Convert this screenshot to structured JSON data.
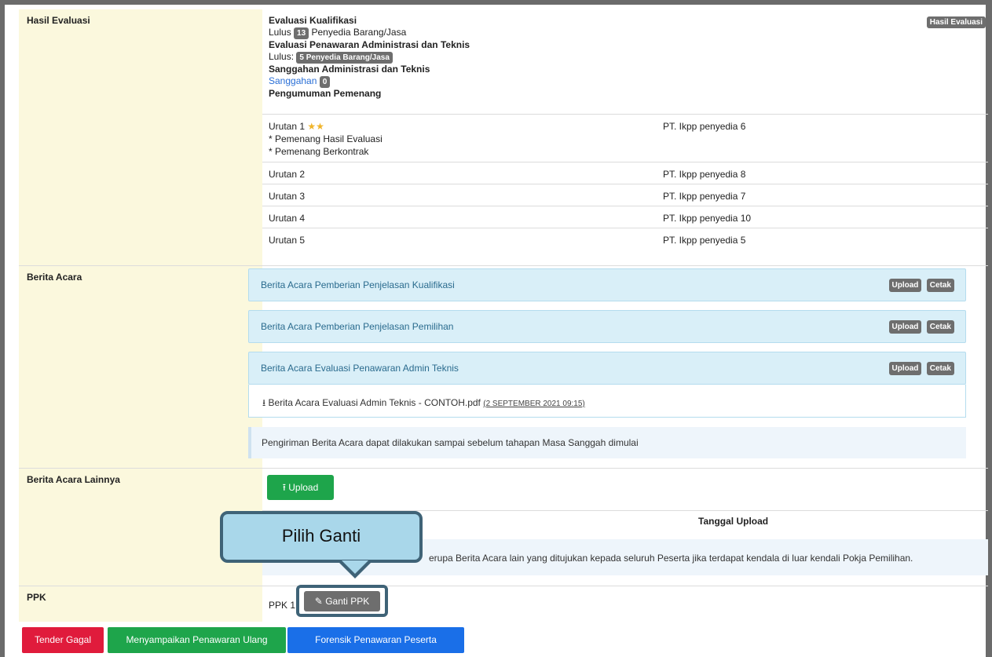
{
  "hasil_evaluasi": {
    "label": "Hasil Evaluasi",
    "corner_badge": "Hasil Evaluasi",
    "kualifikasi_title": "Evaluasi Kualifikasi",
    "kualifikasi_lulus_prefix": "Lulus",
    "kualifikasi_count": "13",
    "kualifikasi_suffix": "Penyedia Barang/Jasa",
    "penawaran_title": "Evaluasi Penawaran Administrasi dan Teknis",
    "penawaran_lulus_prefix": "Lulus:",
    "penawaran_badge": "5 Penyedia Barang/Jasa",
    "sanggahan_title": "Sanggahan Administrasi dan Teknis",
    "sanggahan_link": "Sanggahan",
    "sanggahan_count": "0",
    "pengumuman_title": "Pengumuman Pemenang",
    "urutan": [
      {
        "rank": "Urutan 1",
        "stars": "★★",
        "notes": [
          "* Pemenang Hasil Evaluasi",
          "* Pemenang Berkontrak"
        ],
        "provider": "PT. Ikpp penyedia 6"
      },
      {
        "rank": "Urutan 2",
        "provider": "PT. Ikpp penyedia 8"
      },
      {
        "rank": "Urutan 3",
        "provider": "PT. Ikpp penyedia 7"
      },
      {
        "rank": "Urutan 4",
        "provider": "PT. Ikpp penyedia 10"
      },
      {
        "rank": "Urutan 5",
        "provider": "PT. Ikpp penyedia 5"
      }
    ]
  },
  "berita_acara": {
    "label": "Berita Acara",
    "upload_label": "Upload",
    "cetak_label": "Cetak",
    "panels": [
      {
        "title": "Berita Acara Pemberian Penjelasan Kualifikasi"
      },
      {
        "title": "Berita Acara Pemberian Penjelasan Pemilihan"
      },
      {
        "title": "Berita Acara Evaluasi Penawaran Admin Teknis"
      }
    ],
    "file_name": "Berita Acara Evaluasi Admin Teknis - CONTOH.pdf",
    "file_date": "(2 SEPTEMBER 2021 09:15)",
    "info": "Pengiriman Berita Acara dapat dilakukan sampai sebelum tahapan Masa Sanggah dimulai"
  },
  "berita_acara_lainnya": {
    "label": "Berita Acara Lainnya",
    "upload_button": "Upload",
    "col_tanggal": "Tanggal Upload",
    "info_partial": "erupa Berita Acara lain yang ditujukan kepada seluruh Peserta jika terdapat kendala di luar kendali Pokja Pemilihan."
  },
  "ppk": {
    "label": "PPK",
    "value": "PPK 1",
    "ganti_button": "Ganti PPK"
  },
  "callout": {
    "text": "Pilih Ganti"
  },
  "footer": {
    "tender_gagal": "Tender Gagal",
    "penawaran_ulang": "Menyampaikan Penawaran Ulang",
    "forensik": "Forensik Penawaran Peserta"
  },
  "colors": {
    "label_bg": "#fbf8dd",
    "panel_bg": "#d9eff8",
    "green": "#1ea54b",
    "red": "#e01b3c",
    "blue": "#1a6fe8",
    "callout_bg": "#a9d7ea",
    "callout_border": "#3f6377"
  }
}
